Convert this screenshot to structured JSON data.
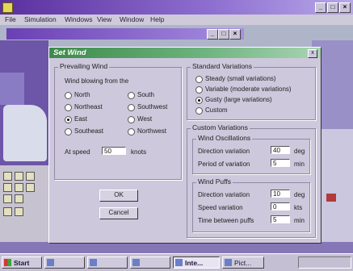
{
  "app": {
    "title": "",
    "menu": [
      "File",
      "Simulation",
      "Windows",
      "View",
      "Window",
      "Help"
    ]
  },
  "child": {
    "title": ""
  },
  "dialog": {
    "title": "Set Wind",
    "close_label": "x",
    "prevailing": {
      "group_label": "Prevailing Wind",
      "blowing_label": "Wind blowing from the",
      "directions": [
        {
          "label": "North",
          "selected": false
        },
        {
          "label": "South",
          "selected": false
        },
        {
          "label": "Northeast",
          "selected": false
        },
        {
          "label": "Southwest",
          "selected": false
        },
        {
          "label": "East",
          "selected": true
        },
        {
          "label": "West",
          "selected": false
        },
        {
          "label": "Southeast",
          "selected": false
        },
        {
          "label": "Northwest",
          "selected": false
        }
      ],
      "speed_label": "At speed",
      "speed_value": "50",
      "speed_unit": "knots"
    },
    "standard": {
      "group_label": "Standard Variations",
      "options": [
        {
          "label": "Steady   (small variations)",
          "selected": false
        },
        {
          "label": "Variable   (moderate variations)",
          "selected": false
        },
        {
          "label": "Gusty   (large variations)",
          "selected": true
        },
        {
          "label": "Custom",
          "selected": false
        }
      ]
    },
    "custom": {
      "group_label": "Custom Variations",
      "oscillations": {
        "label": "Wind Oscillations",
        "rows": [
          {
            "label": "Direction variation",
            "value": "40",
            "unit": "deg"
          },
          {
            "label": "Period of variation",
            "value": "5",
            "unit": "min"
          }
        ]
      },
      "puffs": {
        "label": "Wind Puffs",
        "rows": [
          {
            "label": "Direction variation",
            "value": "10",
            "unit": "deg"
          },
          {
            "label": "Speed variation",
            "value": "0",
            "unit": "kts"
          },
          {
            "label": "Time between puffs",
            "value": "5",
            "unit": "min"
          }
        ]
      }
    },
    "ok_label": "OK",
    "cancel_label": "Cancel"
  },
  "taskbar": {
    "start_label": "Start",
    "items": [
      "",
      "",
      "",
      "Inte...",
      "Pict..."
    ],
    "active_index": 3,
    "clock": ""
  }
}
